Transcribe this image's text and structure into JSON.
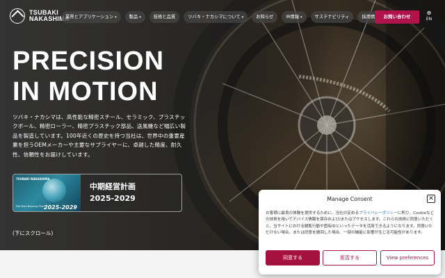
{
  "brand": {
    "logo_line1": "TSUBAKI",
    "logo_line2": "NAKASHIMA"
  },
  "nav": {
    "items": [
      {
        "label": "業界とアプリケーション",
        "has_dropdown": true
      },
      {
        "label": "製品",
        "has_dropdown": true
      },
      {
        "label": "技術と品質",
        "has_dropdown": false
      },
      {
        "label": "ツバキ・ナカシマについて",
        "has_dropdown": true
      },
      {
        "label": "お知らせ",
        "has_dropdown": false
      },
      {
        "label": "IR情報",
        "has_dropdown": true
      },
      {
        "label": "サステナビリティ",
        "has_dropdown": false
      },
      {
        "label": "採用情報",
        "has_dropdown": true
      }
    ],
    "caret": "▾",
    "contact_label": "お問い合わせ",
    "lang_icon": "globe-icon",
    "lang_label": "EN"
  },
  "hero": {
    "headline_line1": "PRECISION",
    "headline_line2": "IN MOTION",
    "lead": "ツバキ・ナカシマは、高性能な精密スチール、セラミック、プラスチックボール、精密ローラー、精密プラスチック部品、送風機など幅広い製品を製造しています。100年近くの歴史を持つ当社は、世界中の重要産業を担うOEMメーカーや主要なサプライヤーに、卓越した精度、耐久性、信頼性をお届けしています。",
    "plan_card": {
      "title_line1": "中期経営計画",
      "title_line2": "2025-2029",
      "thumb_brand": "TSUBAKI NAKASHIMA",
      "thumb_caption": "Mid-Term Business Plan",
      "thumb_years": "2025-2029"
    },
    "scroll_hint": "(下にスクロール)"
  },
  "consent": {
    "title": "Manage Consent",
    "text_before_link": "お客様に最良の体験を提供するために、当社の定める",
    "link_text": "プライバシーポリシー",
    "text_after_link": "に則り、Cookieなどの技術を用いてデバイス情報を保存および/またはアクセスします。これらの技術に同意いただくと、当サイトにおける閲覧行動や固有IDといったデータを活用できるようになります。同意いただけない場合、または同意を撤回した場合、一部の機能に影響が生じる可能性があります。",
    "accept_label": "同意する",
    "deny_label": "拒否する",
    "prefs_label": "View preferences",
    "close_glyph": "✕"
  },
  "colors": {
    "accent": "#b0124a",
    "consent_accent": "#a5123f",
    "link": "#2e6ab8"
  }
}
